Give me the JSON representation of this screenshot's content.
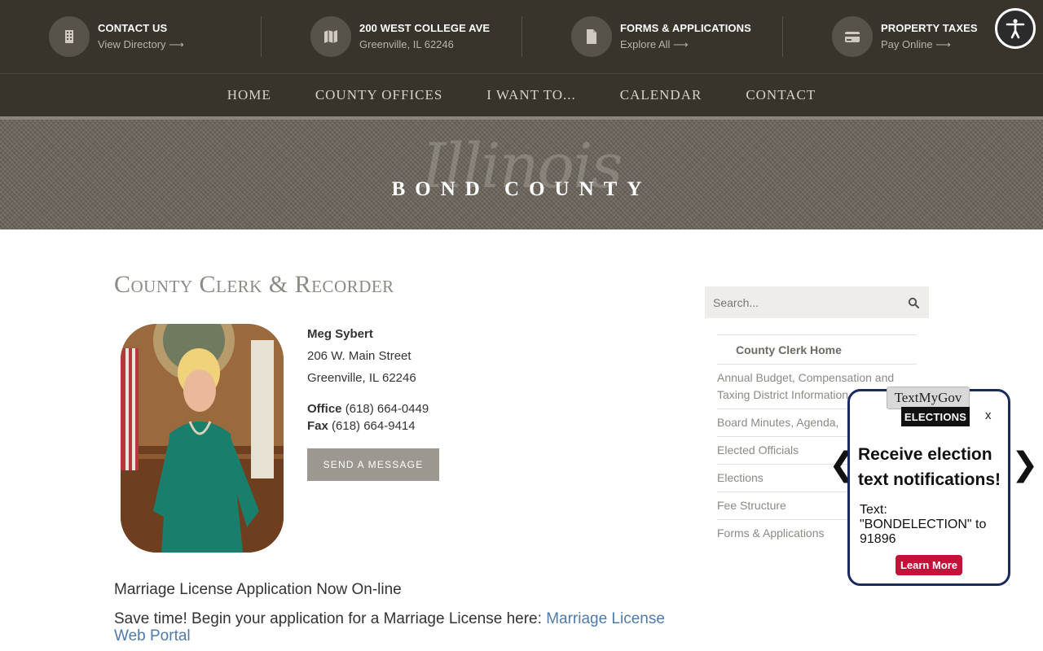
{
  "utility_bar": [
    {
      "title": "CONTACT US",
      "sub": "View Directory ⟶",
      "icon": "building-icon"
    },
    {
      "title": "200 WEST COLLEGE AVE",
      "sub": "Greenville, IL 62246",
      "icon": "map-icon"
    },
    {
      "title": "FORMS & APPLICATIONS",
      "sub": "Explore All ⟶",
      "icon": "document-icon"
    },
    {
      "title": "PROPERTY TAXES",
      "sub": "Pay Online ⟶",
      "icon": "credit-card-icon"
    }
  ],
  "nav": [
    "HOME",
    "COUNTY OFFICES",
    "I WANT TO...",
    "CALENDAR",
    "CONTACT"
  ],
  "banner": {
    "script": "Illinois",
    "name": "BOND COUNTY"
  },
  "page_title": "County Clerk & Recorder",
  "contact": {
    "name": "Meg Sybert",
    "street": "206 W. Main Street",
    "city": "Greenville, IL  62246",
    "office_label": "Office",
    "office": "(618) 664-0449",
    "fax_label": "Fax",
    "fax": "(618) 664-9414",
    "button": "SEND A MESSAGE"
  },
  "marriage": {
    "heading": "Marriage License Application Now On-line",
    "text": "Save time! Begin your application for a Marriage License here: ",
    "link": "Marriage License Web Portal"
  },
  "sidebar": {
    "search_placeholder": "Search...",
    "items": [
      "County Clerk Home",
      "Annual Budget, Compensation and Taxing District Information",
      "Board Minutes, Agenda,",
      "Elected Officials",
      "Elections",
      "Fee Structure",
      "Forms & Applications"
    ]
  },
  "popup": {
    "logo_top": "TextMyGov",
    "logo_bottom": "ELECTIONS",
    "close": "x",
    "heading": "Receive election text notifications!",
    "text": "Text: \"BONDELECTION\" to 91896",
    "button": "Learn More",
    "prev": "❮",
    "next": "❯"
  },
  "colors": {
    "header_bg": "#38342c",
    "popup_border": "#1a2a5c",
    "button_red": "#c1123a",
    "link": "#4e7ba8"
  }
}
